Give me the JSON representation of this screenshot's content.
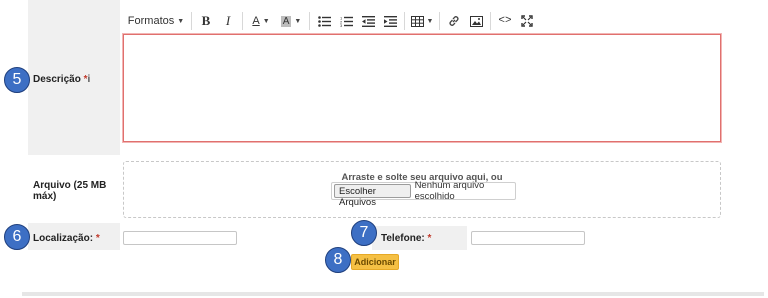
{
  "toolbar": {
    "formats_label": "Formatos",
    "icons": [
      "bold-icon",
      "italic-icon",
      "font-color-icon",
      "background-color-icon",
      "bullet-list-icon",
      "numbered-list-icon",
      "outdent-icon",
      "indent-icon",
      "table-icon",
      "link-icon",
      "image-icon",
      "source-code-icon",
      "fullscreen-icon"
    ]
  },
  "description": {
    "label": "Descrição",
    "required_mark": "*",
    "info_mark": "i"
  },
  "attachment": {
    "label_line1": "Arquivo (25 MB",
    "label_line2": "máx)",
    "drop_text": "Arraste e solte seu arquivo aqui, ou",
    "choose_button": "Escolher Arquivos",
    "no_file_text": "Nenhum arquivo escolhido"
  },
  "location": {
    "label": "Localização:",
    "required_mark": "*",
    "value": ""
  },
  "phone": {
    "label": "Telefone:",
    "required_mark": "*",
    "value": ""
  },
  "add_button": "Adicionar",
  "badges": {
    "b5": "5",
    "b6": "6",
    "b7": "7",
    "b8": "8"
  },
  "colors": {
    "badge": "#3d6fc4",
    "add_button": "#f5c044",
    "error_border": "#e0706e"
  }
}
